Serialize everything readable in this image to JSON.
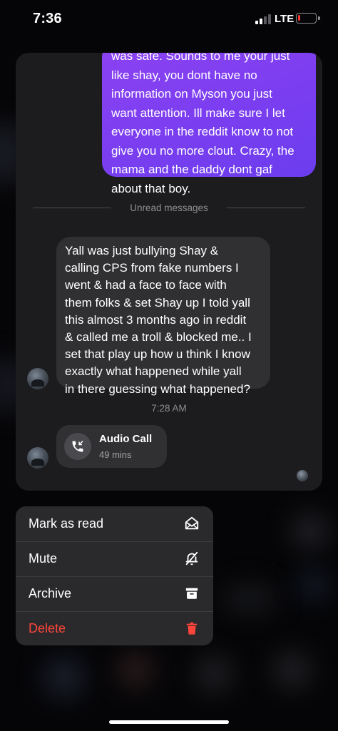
{
  "status_bar": {
    "time": "7:36",
    "network": "LTE",
    "battery_level": 0.12,
    "battery_color": "#ff3b30"
  },
  "chat": {
    "outgoing_message_lines": [
      "was safe. Sounds to me your just",
      "like shay, you dont have no",
      "information on Myson you just",
      "want attention. Ill make sure I let",
      "everyone in the reddit know to not",
      "give you no more clout. Crazy, the",
      "mama and the daddy dont gaf",
      "about that boy."
    ],
    "unread_divider": "Unread messages",
    "incoming_message_lines": [
      "Yall was just bullying Shay &",
      "calling CPS from fake numbers I",
      "went & had a face to face with",
      "them folks & set Shay up I told yall",
      "this almost 3 months ago in reddit",
      "& called me a troll & blocked me.. I",
      "set that play up how u think I know",
      "exactly what happened while yall",
      "in there guessing what happened?"
    ],
    "timestamp": "7:28 AM",
    "call": {
      "title": "Audio Call",
      "duration": "49 mins",
      "icon": "missed-call-icon"
    },
    "outgoing_gradient": [
      "#8c42f2",
      "#6b3dee"
    ]
  },
  "menu": {
    "items": [
      {
        "label": "Mark as read",
        "icon": "envelope-open-icon"
      },
      {
        "label": "Mute",
        "icon": "bell-slash-icon"
      },
      {
        "label": "Archive",
        "icon": "archive-box-icon"
      },
      {
        "label": "Delete",
        "icon": "trash-icon",
        "color": "#ff453a"
      }
    ]
  }
}
